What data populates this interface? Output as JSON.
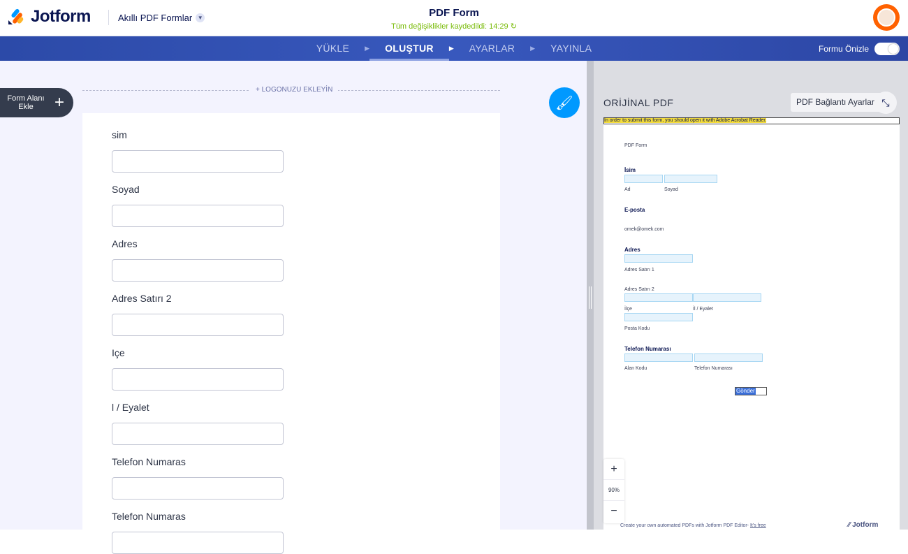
{
  "header": {
    "brand": "Jotform",
    "product": "Akıllı PDF Formlar",
    "title": "PDF Form",
    "saved_status": "Tüm değişiklikler kaydedildi: 14:29"
  },
  "nav": {
    "steps": [
      "YÜKLE",
      "OLUŞTUR",
      "AYARLAR",
      "YAYINLA"
    ],
    "active": "OLUŞTUR",
    "preview_label": "Formu Önizle"
  },
  "builder": {
    "add_field": "Form Alanı Ekle",
    "add_logo": "+ LOGONUZU EKLEYİN",
    "fields": [
      "sim",
      "Soyad",
      "Adres",
      "Adres Satırı 2",
      "Içe",
      "l / Eyalet",
      "Telefon Numaras",
      "Telefon Numaras"
    ]
  },
  "pdf": {
    "heading": "ORİJİNAL PDF",
    "settings_button": "PDF Bağlantı Ayarları",
    "notice": "In order to submit this form, you should open it with Adobe Acrobat Reader.",
    "form_title": "PDF Form",
    "name_label": "İsim",
    "first": "Ad",
    "last": "Soyad",
    "email_label": "E-posta",
    "email_example": "omek@omek.com",
    "address_label": "Adres",
    "addr1": "Adres Satırı 1",
    "addr2": "Adres Satırı 2",
    "district": "İlçe",
    "province": "İl / Eyalet",
    "zip": "Posta Kodu",
    "phone_label": "Telefon Numarası",
    "area": "Alan Kodu",
    "phone": "Telefon Numarası",
    "submit": "Gönder",
    "zoom": "90%",
    "footer": "Create your own automated PDFs with Jotform PDF Editor-",
    "footer_link": "It's free",
    "footer_brand": "Jotform"
  },
  "colors": {
    "nav": "#3453b5",
    "accent": "#0099ff",
    "saved": "#78bb07"
  }
}
